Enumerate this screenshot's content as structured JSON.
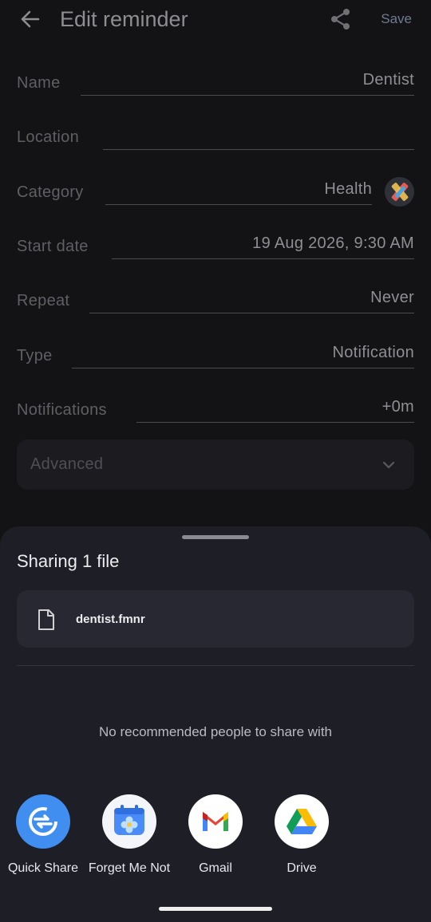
{
  "header": {
    "title": "Edit reminder",
    "back_icon": "arrow-left-icon",
    "share_icon": "share-icon",
    "save_label": "Save"
  },
  "form": {
    "name": {
      "label": "Name",
      "value": "Dentist"
    },
    "location": {
      "label": "Location",
      "value": ""
    },
    "category": {
      "label": "Category",
      "value": "Health",
      "icon": "category-health-icon"
    },
    "start_date": {
      "label": "Start date",
      "value": "19 Aug 2026, 9:30 AM"
    },
    "repeat": {
      "label": "Repeat",
      "value": "Never"
    },
    "type": {
      "label": "Type",
      "value": "Notification"
    },
    "notifications": {
      "label": "Notifications",
      "value": "+0m"
    },
    "advanced": {
      "label": "Advanced",
      "icon": "chevron-down-icon"
    }
  },
  "share_sheet": {
    "title": "Sharing 1 file",
    "file": {
      "name": "dentist.fmnr",
      "icon": "file-icon"
    },
    "no_people": "No recommended people to share with",
    "apps": [
      {
        "label": "Quick Share",
        "icon": "quick-share-icon",
        "color": "#3f8ef0"
      },
      {
        "label": "Forget Me Not",
        "icon": "forget-me-not-icon",
        "color": "#4a8cf7"
      },
      {
        "label": "Gmail",
        "icon": "gmail-icon",
        "color": "#ea4335"
      },
      {
        "label": "Drive",
        "icon": "drive-icon",
        "color": "#34a853"
      }
    ]
  }
}
